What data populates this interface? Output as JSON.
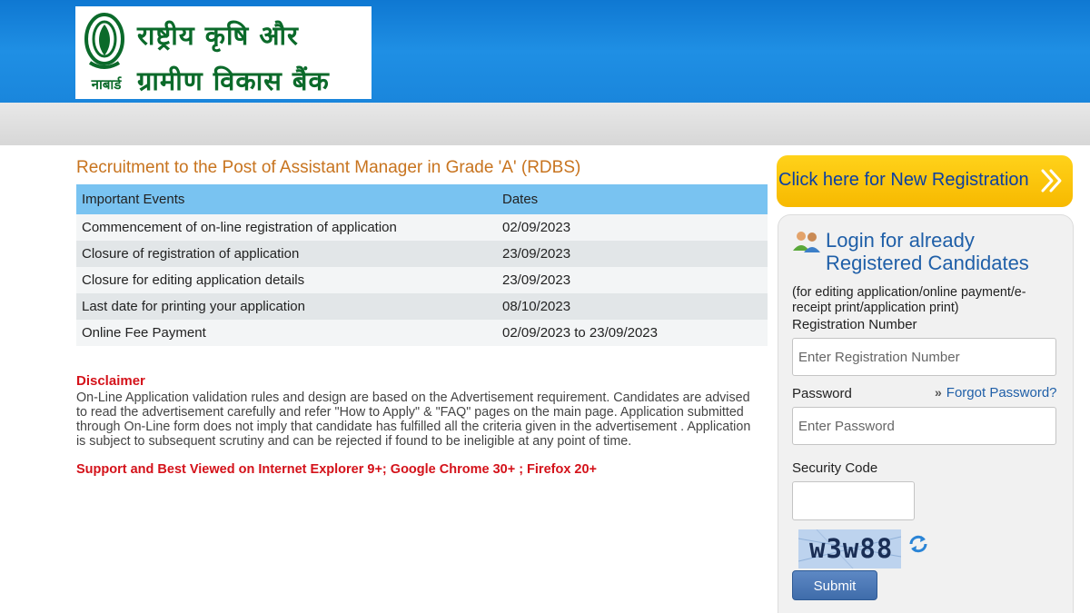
{
  "header": {
    "logo": {
      "line1": "राष्ट्रीय कृषि और",
      "line2": "ग्रामीण विकास बैंक",
      "abbr": "नाबार्ड"
    }
  },
  "main": {
    "title": "Recruitment to the Post of Assistant Manager in Grade 'A' (RDBS)",
    "table": {
      "headers": [
        "Important Events",
        "Dates"
      ],
      "rows": [
        [
          "Commencement of on-line registration of application",
          "02/09/2023"
        ],
        [
          "Closure of registration of application",
          "23/09/2023"
        ],
        [
          "Closure for editing application details",
          "23/09/2023"
        ],
        [
          "Last date for printing your application",
          "08/10/2023"
        ],
        [
          "Online Fee Payment",
          "02/09/2023 to 23/09/2023"
        ]
      ]
    },
    "disclaimer": {
      "title": "Disclaimer",
      "text": "On-Line Application validation rules and design are based on the Advertisement requirement. Candidates are advised to read the advertisement carefully and refer \"How to Apply\" & \"FAQ\" pages on the main page. Application submitted through On-Line form does not imply that candidate has fulfilled all the criteria given in the advertisement . Application is subject to subsequent scrutiny and can be rejected if found to be ineligible at any point of time."
    },
    "support_note": "Support and Best Viewed on Internet Explorer 9+; Google Chrome 30+ ; Firefox 20+"
  },
  "sidebar": {
    "new_registration_label": "Click here for New Registration",
    "login": {
      "title_line1": "Login for already",
      "title_line2": "Registered Candidates",
      "subtitle": "(for editing application/online payment/e-receipt print/application print)",
      "registration_label": "Registration Number",
      "registration_placeholder": "Enter Registration Number",
      "password_label": "Password",
      "password_placeholder": "Enter Password",
      "forgot_password": "Forgot Password?",
      "forgot_chevron": "»",
      "security_code_label": "Security Code",
      "captcha_text": "w3w88",
      "submit_label": "Submit"
    }
  },
  "colors": {
    "header_blue": "#1a86dc",
    "title_orange": "#c8741f",
    "table_header": "#79c3f1",
    "alert_red": "#d4121a",
    "register_yellow": "#f7b900",
    "link_blue": "#1f5fa8"
  },
  "icons": [
    "nabard-emblem-icon",
    "chevron-double-right-icon",
    "users-icon",
    "refresh-icon"
  ]
}
